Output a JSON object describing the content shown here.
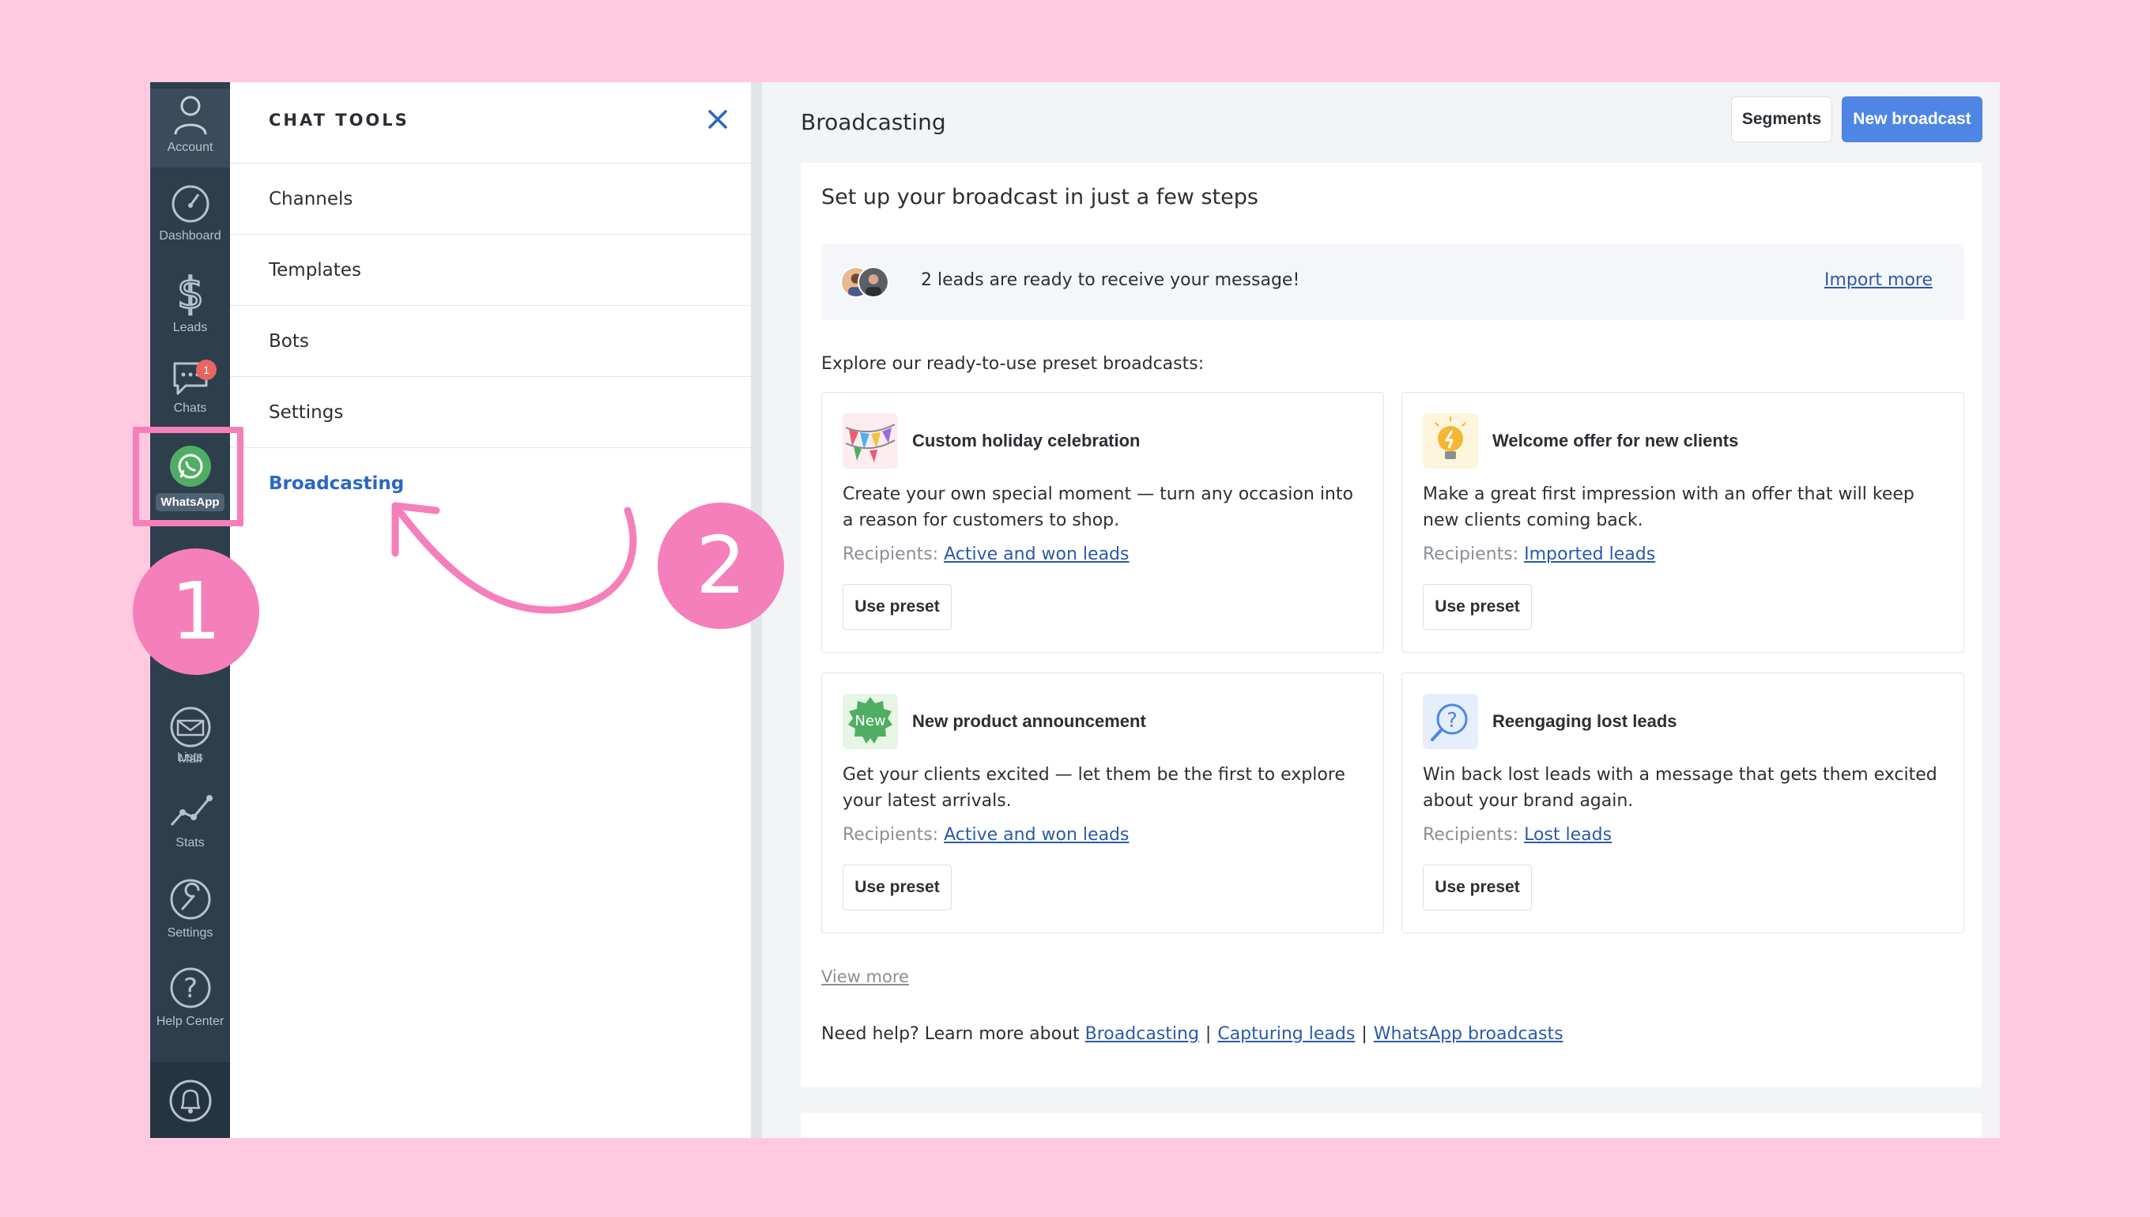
{
  "nav": {
    "account": "Account",
    "dashboard": "Dashboard",
    "leads": "Leads",
    "chats": "Chats",
    "chats_badge": "1",
    "whatsapp": "WhatsApp",
    "lists": "Lists",
    "mail": "Mail",
    "stats": "Stats",
    "settings": "Settings",
    "help_center": "Help Center"
  },
  "tools": {
    "title": "CHAT TOOLS",
    "items": [
      "Channels",
      "Templates",
      "Bots",
      "Settings",
      "Broadcasting"
    ],
    "active_item": "Broadcasting"
  },
  "main": {
    "title": "Broadcasting",
    "segments_button": "Segments",
    "new_broadcast_button": "New broadcast",
    "card_title": "Set up your broadcast in just a few steps",
    "leads_banner": {
      "text": "2 leads are ready to receive your message!",
      "link": "Import more"
    },
    "explore_text": "Explore our ready-to-use preset broadcasts:",
    "recipients_label": "Recipients:",
    "use_preset_label": "Use preset",
    "presets": [
      {
        "title": "Custom holiday celebration",
        "description": "Create your own special moment — turn any occasion into a reason for customers to shop.",
        "recipients": "Active and won leads",
        "icon": "bunting-flags-icon"
      },
      {
        "title": "Welcome offer for new clients",
        "description": "Make a great first impression with an offer that will keep new clients coming back.",
        "recipients": "Imported leads",
        "icon": "lightbulb-icon"
      },
      {
        "title": "New product announcement",
        "description": "Get your clients excited — let them be the first to explore your latest arrivals.",
        "recipients": "Active and won leads",
        "icon": "new-badge-icon",
        "icon_text": "New"
      },
      {
        "title": "Reengaging lost leads",
        "description": "Win back lost leads with a message that gets them excited about your brand again.",
        "recipients": "Lost leads",
        "icon": "question-search-icon"
      }
    ],
    "view_more": "View more",
    "help": {
      "prefix": "Need help? Learn more about",
      "links": [
        "Broadcasting",
        "Capturing leads",
        "WhatsApp broadcasts"
      ],
      "separator": "|"
    }
  },
  "annotations": {
    "step1": "1",
    "step2": "2"
  },
  "colors": {
    "background": "#ffc9e0",
    "annotation": "#f57fba",
    "nav": "#2d3e4d",
    "accent": "#4f86e6",
    "link": "#2a5aa8",
    "active_tool": "#2a67c4"
  }
}
